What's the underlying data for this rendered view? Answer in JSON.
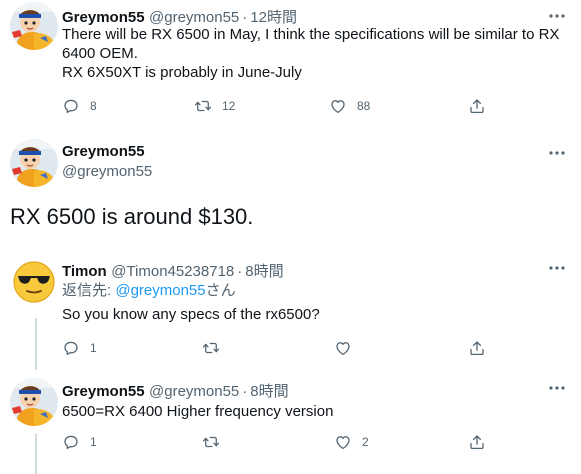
{
  "tweet1": {
    "name": "Greymon55",
    "handle": "@greymon55",
    "time": "12時間",
    "text_line1": "There will be RX 6500 in May, I think the specifications will be similar to RX",
    "text_line2": "6400 OEM.",
    "text_line3": "RX 6X50XT is probably in June-July",
    "replies": "8",
    "retweets": "12",
    "likes": "88"
  },
  "tweet2": {
    "name": "Greymon55",
    "handle": "@greymon55",
    "text": "RX 6500 is around $130."
  },
  "tweet3": {
    "name": "Timon",
    "handle": "@Timon45238718",
    "time": "8時間",
    "reply_prefix": "返信先: ",
    "reply_mention": "@greymon55",
    "reply_suffix": "さん",
    "text": "So you know any specs of the rx6500?",
    "replies": "1"
  },
  "tweet4": {
    "name": "Greymon55",
    "handle": "@greymon55",
    "time": "8時間",
    "text": "6500=RX 6400 Higher frequency version",
    "replies": "1",
    "likes": "2"
  },
  "separator": "·",
  "icons": {
    "reply": "reply-icon",
    "retweet": "retweet-icon",
    "like": "heart-icon",
    "share": "share-icon",
    "more": "more-icon"
  }
}
